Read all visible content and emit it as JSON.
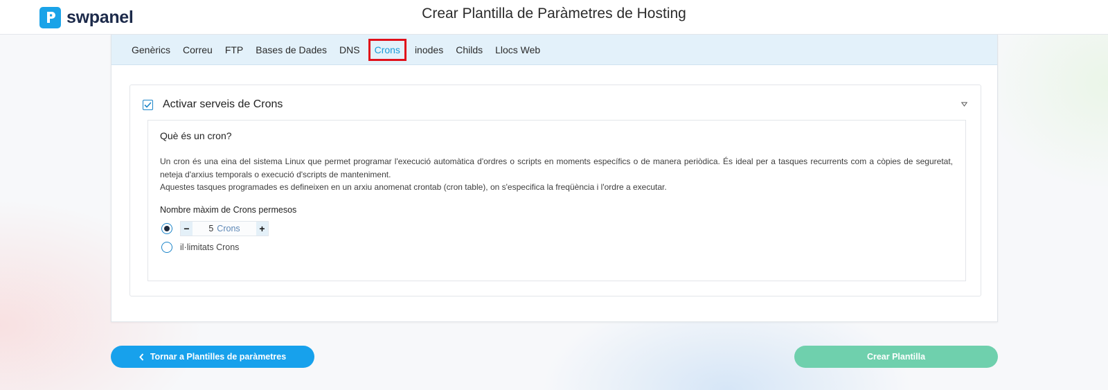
{
  "header": {
    "logo_text": "swpanel",
    "title": "Crear Plantilla de Paràmetres de Hosting"
  },
  "tabs": [
    {
      "label": "Genèrics",
      "active": false
    },
    {
      "label": "Correu",
      "active": false
    },
    {
      "label": "FTP",
      "active": false
    },
    {
      "label": "Bases de Dades",
      "active": false
    },
    {
      "label": "DNS",
      "active": false
    },
    {
      "label": "Crons",
      "active": true
    },
    {
      "label": "inodes",
      "active": false
    },
    {
      "label": "Childs",
      "active": false
    },
    {
      "label": "Llocs Web",
      "active": false
    }
  ],
  "section": {
    "title": "Activar serveis de Crons",
    "enabled": true,
    "info": {
      "heading": "Què és un cron?",
      "paragraph1": "Un cron és una eina del sistema Linux que permet programar l'execució automàtica d'ordres o scripts en moments específics o de manera periòdica. És ideal per a tasques recurrents com a còpies de seguretat, neteja d'arxius temporals o execució d'scripts de manteniment.",
      "paragraph2": "Aquestes tasques programades es defineixen en un arxiu anomenat crontab (cron table), on s'especifica la freqüència i l'ordre a executar."
    },
    "limit_label": "Nombre màxim de Crons permesos",
    "stepper": {
      "minus": "−",
      "plus": "+",
      "value": "5",
      "unit": "Crons",
      "selected": true
    },
    "unlimited_label": "il·limitats Crons"
  },
  "footer": {
    "back_label": "Tornar a Plantilles de paràmetres",
    "create_label": "Crear Plantilla"
  },
  "colors": {
    "accent": "#17a1ec",
    "create_button": "#6fd0ad",
    "active_tab": "#1a9ad6",
    "highlight_box": "#e0101a"
  },
  "icons": {
    "logo": "swpanel-logo-icon",
    "check": "checkmark-icon",
    "collapse": "triangle-down-icon",
    "back": "chevron-left-icon"
  }
}
